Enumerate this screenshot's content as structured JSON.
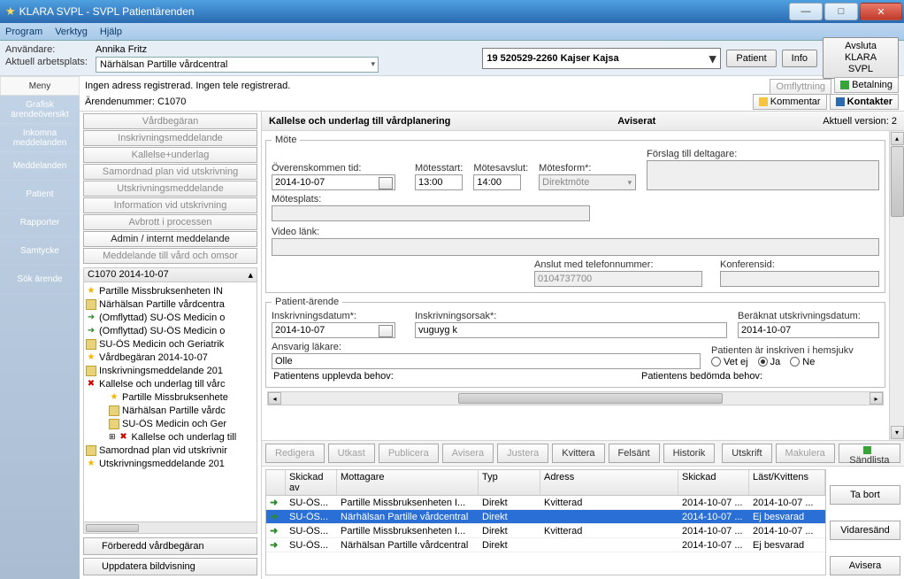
{
  "window": {
    "title": "KLARA SVPL - SVPL Patientärenden"
  },
  "menu": {
    "items": [
      "Program",
      "Verktyg",
      "Hjälp"
    ]
  },
  "info": {
    "user_label": "Användare:",
    "user": "Annika Fritz",
    "workplace_label": "Aktuell arbetsplats:",
    "workplace": "Närhälsan Partille vårdcentral",
    "patient_id": "19 520529-2260 Kajser Kajsa",
    "patient_btn": "Patient",
    "info_btn": "Info",
    "quit_btn": "Avsluta\nKLARA SVPL"
  },
  "strip": {
    "alerts": "Ingen adress registrerad.  Ingen tele registrerad.",
    "case_label": "Ärendenummer:",
    "case_no": "C1070",
    "btn_omflytt": "Omflyttning",
    "btn_betal": "Betalning",
    "btn_komm": "Kommentar",
    "btn_kont": "Kontakter"
  },
  "leftnav": [
    "Meny",
    "Grafisk ärendeöversikt",
    "Inkomna meddelanden",
    "Meddelanden",
    "Patient",
    "Rapporter",
    "Samtycke",
    "Sök ärende"
  ],
  "casebtns": [
    {
      "label": "Vårdbegäran",
      "dis": true
    },
    {
      "label": "Inskrivningsmeddelande",
      "dis": true
    },
    {
      "label": "Kallelse+underlag",
      "dis": true
    },
    {
      "label": "Samordnad plan vid utskrivning",
      "dis": true
    },
    {
      "label": "Utskrivningsmeddelande",
      "dis": true
    },
    {
      "label": "Information vid utskrivning",
      "dis": true
    },
    {
      "label": "Avbrott i processen",
      "dis": true
    },
    {
      "label": "Admin / internt meddelande",
      "dis": false
    },
    {
      "label": "Meddelande till vård och omsor",
      "dis": true
    }
  ],
  "tree": {
    "header": "C1070 2014-10-07",
    "nodes": [
      {
        "ic": "star",
        "txt": "Partille Missbruksenheten IN",
        "lvl": 0
      },
      {
        "ic": "doc",
        "txt": "Närhälsan Partille vårdcentra",
        "lvl": 0
      },
      {
        "ic": "arrow",
        "txt": "(Omflyttad) SU-ÖS Medicin o",
        "lvl": 0
      },
      {
        "ic": "arrow",
        "txt": "(Omflyttad) SU-ÖS Medicin o",
        "lvl": 0
      },
      {
        "ic": "doc",
        "txt": "SU-ÖS Medicin och Geriatrik",
        "lvl": 0
      },
      {
        "ic": "star",
        "txt": "Vårdbegäran 2014-10-07",
        "lvl": 0
      },
      {
        "ic": "doc",
        "txt": "Inskrivningsmeddelande 201",
        "lvl": 0
      },
      {
        "ic": "redx",
        "txt": "Kallelse och underlag till vårc",
        "lvl": 0
      },
      {
        "ic": "star",
        "txt": "Partille Missbruksenhete",
        "lvl": 1
      },
      {
        "ic": "doc",
        "txt": "Närhälsan Partille vårdc",
        "lvl": 1
      },
      {
        "ic": "doc",
        "txt": "SU-ÖS Medicin och Ger",
        "lvl": 1
      },
      {
        "ic": "redx",
        "txt": "Kallelse och underlag till",
        "lvl": 1,
        "exp": "⊞"
      },
      {
        "ic": "doc",
        "txt": "Samordnad plan vid utskrivnir",
        "lvl": 0
      },
      {
        "ic": "star",
        "txt": "Utskrivningsmeddelande 201",
        "lvl": 0
      }
    ]
  },
  "bottombtns": {
    "prep": "Förberedd vårdbegäran",
    "upd": "Uppdatera bildvisning"
  },
  "form": {
    "title": "Kallelse och underlag till vårdplanering",
    "status": "Aviserat",
    "version": "Aktuell version: 2",
    "mote_legend": "Möte",
    "agreed_label": "Överenskommen tid:",
    "agreed": "2014-10-07",
    "start_label": "Mötesstart:",
    "start": "13:00",
    "end_label": "Mötesavslut:",
    "end": "14:00",
    "form_label": "Mötesform*:",
    "formval": "Direktmöte",
    "deltag_label": "Förslag till deltagare:",
    "plats_label": "Mötesplats:",
    "video_label": "Video länk:",
    "tel_label": "Anslut med telefonnummer:",
    "tel": "0104737700",
    "konf_label": "Konferensid:",
    "pat_legend": "Patient-ärende",
    "insk_label": "Inskrivningsdatum*:",
    "insk": "2014-10-07",
    "orsak_label": "Inskrivningsorsak*:",
    "orsak": "vuguyg  k",
    "berak_label": "Beräknat utskrivningsdatum:",
    "berak": "2014-10-07",
    "ansv_label": "Ansvarig läkare:",
    "ansv": "Olle",
    "hemsjuk_label": "Patienten är inskriven i hemsjukv",
    "r_vetej": "Vet ej",
    "r_ja": "Ja",
    "r_nej": "Ne",
    "upplev": "Patientens upplevda behov:",
    "bedom": "Patientens bedömda behov:"
  },
  "btnbar": {
    "redigera": "Redigera",
    "utkast": "Utkast",
    "publicera": "Publicera",
    "avisera": "Avisera",
    "justera": "Justera",
    "kvittera": "Kvittera",
    "felsant": "Felsänt",
    "historik": "Historik",
    "utskrift": "Utskrift",
    "makulera": "Makulera",
    "sandlista": "Sändlista"
  },
  "grid": {
    "hdr": {
      "sent": "Skickad av",
      "recv": "Mottagare",
      "typ": "Typ",
      "adr": "Adress",
      "sk": "Skickad",
      "last": "Läst/Kvittens"
    },
    "rows": [
      {
        "sent": "SU-ÖS...",
        "recv": "Partille Missbruksenheten I...",
        "typ": "Direkt",
        "adr": "Kvitterad",
        "sk": "2014-10-07 ...",
        "last": "2014-10-07 ...",
        "sel": false
      },
      {
        "sent": "SU-ÖS...",
        "recv": "Närhälsan Partille vårdcentral",
        "typ": "Direkt",
        "adr": "",
        "sk": "2014-10-07 ...",
        "last": "Ej besvarad",
        "sel": true
      },
      {
        "sent": "SU-ÖS...",
        "recv": "Partille Missbruksenheten I...",
        "typ": "Direkt",
        "adr": "Kvitterad",
        "sk": "2014-10-07 ...",
        "last": "2014-10-07 ...",
        "sel": false
      },
      {
        "sent": "SU-ÖS...",
        "recv": "Närhälsan Partille vårdcentral",
        "typ": "Direkt",
        "adr": "",
        "sk": "2014-10-07 ...",
        "last": "Ej besvarad",
        "sel": false
      }
    ]
  },
  "sidebtns": {
    "tabort": "Ta bort",
    "vidare": "Vidaresänd",
    "avisera": "Avisera"
  }
}
